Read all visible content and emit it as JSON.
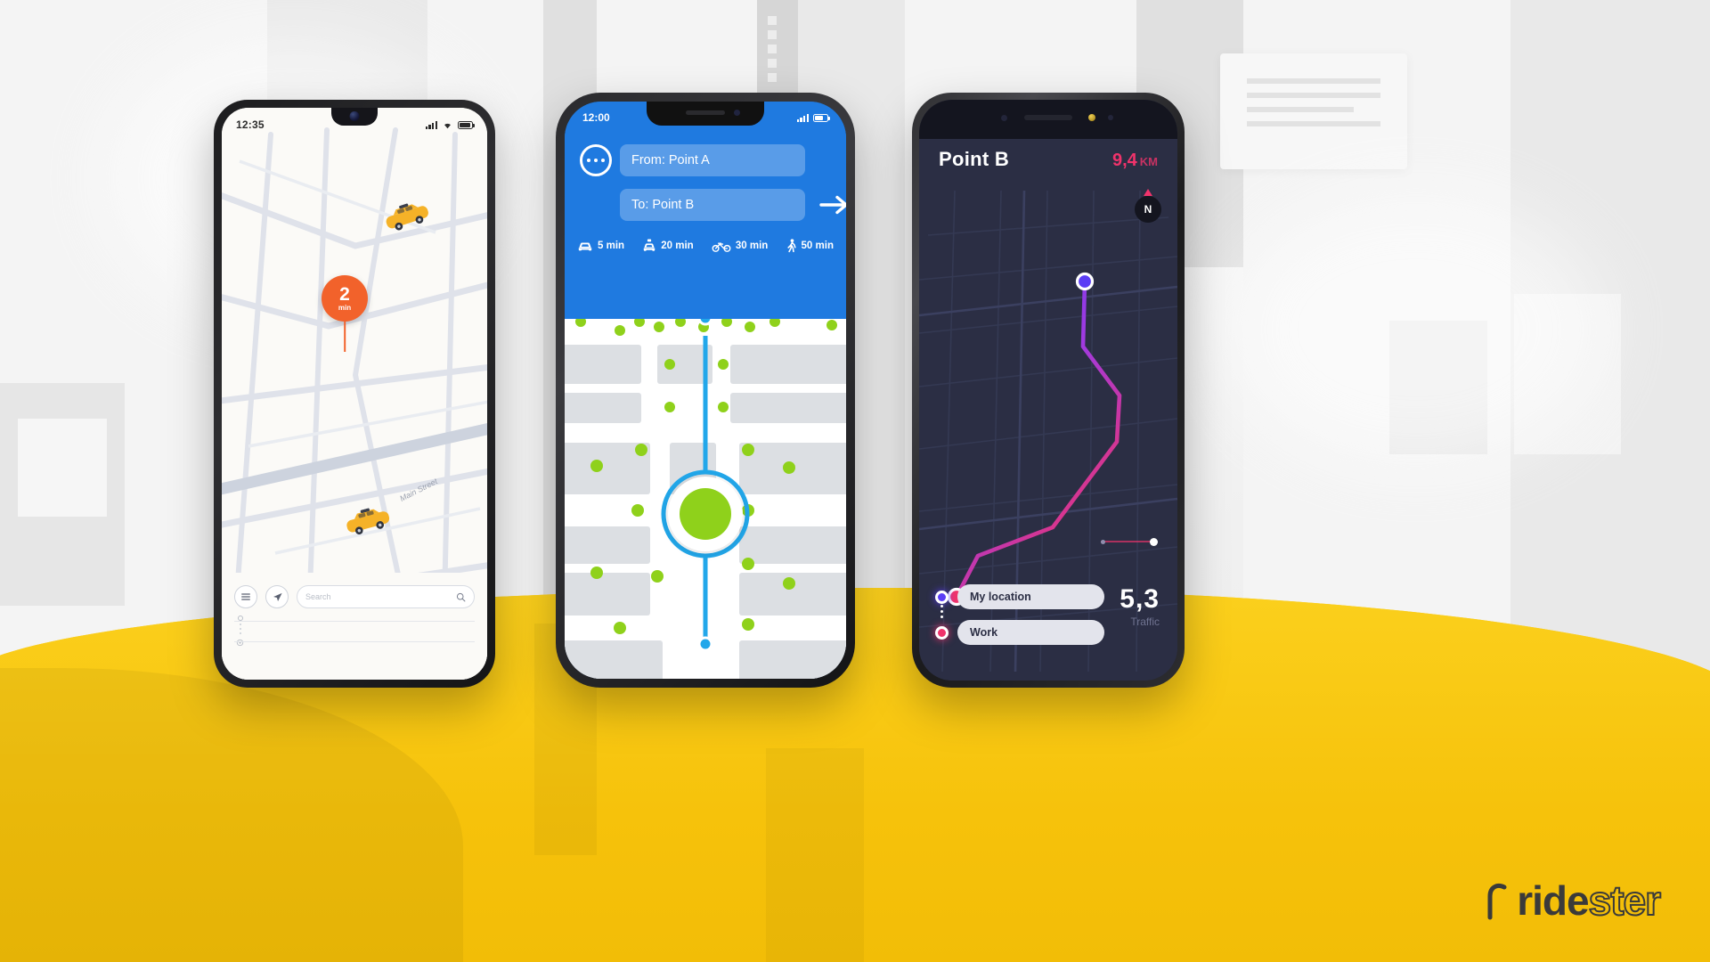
{
  "scene": {
    "background_color": "#f2f2f2",
    "road_color": "#f9c80e"
  },
  "brand": {
    "name": "ridester",
    "part_solid": "ride",
    "part_outline": "ster"
  },
  "phone1": {
    "platform": "android",
    "status": {
      "time": "12:35",
      "signal_icon": "signal-bars-icon",
      "wifi_icon": "wifi-icon",
      "battery_icon": "battery-icon"
    },
    "map": {
      "eta_pin": {
        "value": "2",
        "unit": "min",
        "color": "#f2622b"
      },
      "street_label": "Main Street",
      "vehicles": [
        {
          "name": "taxi-car-icon",
          "color": "#f5b228"
        },
        {
          "name": "taxi-car-icon",
          "color": "#f5b228"
        }
      ]
    },
    "bottom": {
      "menu_icon": "menu-icon",
      "navigate_icon": "navigation-arrow-icon",
      "search_placeholder": "Search",
      "search_value": "",
      "search_icon": "search-icon"
    }
  },
  "phone2": {
    "platform": "ios",
    "status": {
      "time": "12:00",
      "signal_icon": "signal-bars-icon",
      "battery_icon": "battery-icon"
    },
    "header": {
      "accent_color": "#1f7ae0",
      "more_icon": "more-options-icon",
      "from_field": "From: Point A",
      "from_placeholder": "From:",
      "to_field": "To: Point B",
      "to_placeholder": "To:",
      "go_icon": "arrow-right-icon"
    },
    "modes": [
      {
        "icon": "car-icon",
        "label": "5 min"
      },
      {
        "icon": "taxi-icon",
        "label": "20 min"
      },
      {
        "icon": "bike-icon",
        "label": "30 min"
      },
      {
        "icon": "walk-icon",
        "label": "50 min"
      }
    ],
    "map": {
      "destination_pin_icon": "map-pin-icon",
      "destination_pin_color": "#e8262b",
      "current_position_color": "#8fd11b",
      "route_color": "#22a7ea"
    }
  },
  "phone3": {
    "platform": "android-dark",
    "header": {
      "title": "Point B",
      "distance_value": "9,4",
      "distance_unit": "KM",
      "distance_color": "#f0336b"
    },
    "compass": {
      "label": "N",
      "icon": "compass-icon"
    },
    "route": {
      "start_color": "#5b3df5",
      "end_color": "#f0336b"
    },
    "slider": {
      "name": "zoom-slider"
    },
    "stops": [
      {
        "label": "My location",
        "marker_color": "#5b3df5"
      },
      {
        "label": "Work",
        "marker_color": "#f0336b"
      }
    ],
    "traffic": {
      "value": "5,3",
      "label": "Traffic"
    }
  }
}
